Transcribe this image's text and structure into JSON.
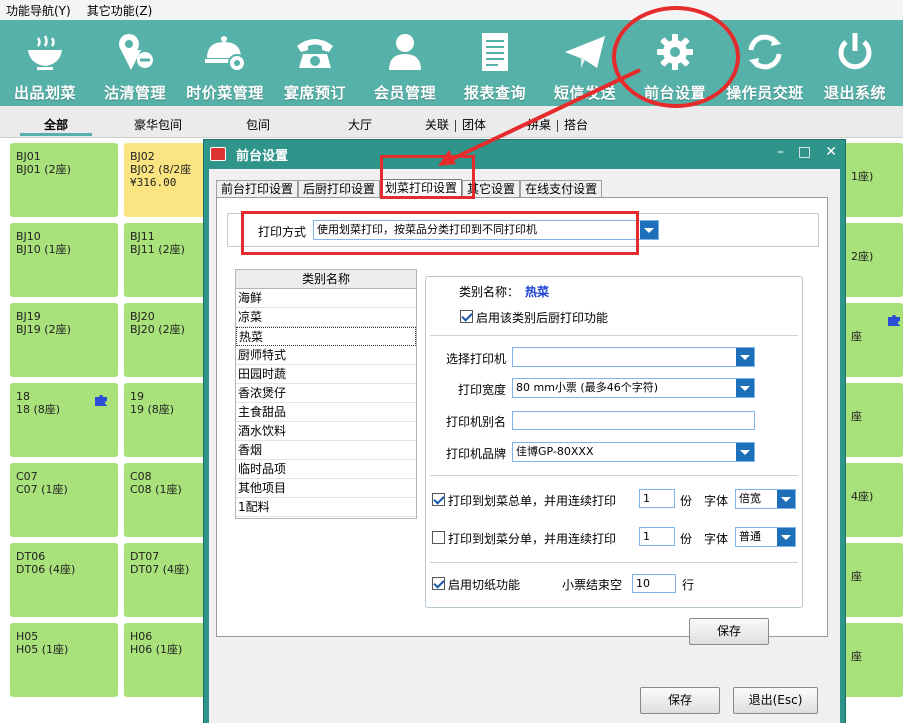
{
  "menu": [
    "功能导航(Y)",
    "其它功能(Z)"
  ],
  "toolbar": [
    {
      "label": "出品划菜",
      "icon": "bowl-icon"
    },
    {
      "label": "沽清管理",
      "icon": "tag-icon"
    },
    {
      "label": "时价菜管理",
      "icon": "food-gear-icon"
    },
    {
      "label": "宴席预订",
      "icon": "phone-icon"
    },
    {
      "label": "会员管理",
      "icon": "user-icon"
    },
    {
      "label": "报表查询",
      "icon": "report-icon"
    },
    {
      "label": "短信发送",
      "icon": "mail-icon"
    },
    {
      "label": "前台设置",
      "icon": "gear-icon"
    },
    {
      "label": "操作员交班",
      "icon": "refresh-icon"
    },
    {
      "label": "退出系统",
      "icon": "power-icon"
    }
  ],
  "areas": [
    "全部",
    "豪华包间",
    "包间",
    "大厅",
    "关联",
    "团体",
    "拼桌",
    "搭台"
  ],
  "tables": [
    {
      "name": "BJ01",
      "seat": "BJ01 (2座)",
      "amount": ""
    },
    {
      "name": "BJ02",
      "seat": "BJ02 (8/2座",
      "amount": "¥316.00"
    },
    {
      "name": "BJ10",
      "seat": "BJ10 (1座)",
      "amount": ""
    },
    {
      "name": "BJ11",
      "seat": "BJ11 (2座)",
      "amount": ""
    },
    {
      "name": "BJ19",
      "seat": "BJ19 (2座)",
      "amount": ""
    },
    {
      "name": "BJ20",
      "seat": "BJ20 (2座)",
      "amount": ""
    },
    {
      "name": "18",
      "seat": "18 (8座)",
      "amount": ""
    },
    {
      "name": "19",
      "seat": "19 (8座)",
      "amount": ""
    },
    {
      "name": "C07",
      "seat": "C07 (1座)",
      "amount": ""
    },
    {
      "name": "C08",
      "seat": "C08 (1座)",
      "amount": ""
    },
    {
      "name": "DT06",
      "seat": "DT06 (4座)",
      "amount": ""
    },
    {
      "name": "DT07",
      "seat": "DT07 (4座)",
      "amount": ""
    },
    {
      "name": "H05",
      "seat": "H05 (1座)",
      "amount": ""
    },
    {
      "name": "H06",
      "seat": "H06 (1座)",
      "amount": ""
    }
  ],
  "right_tiles": [
    "1座)",
    "2座)",
    "座",
    "座",
    "4座)",
    "座",
    "座"
  ],
  "dialog": {
    "title": "前台设置",
    "tabs": [
      "前台打印设置",
      "后厨打印设置",
      "划菜打印设置",
      "其它设置",
      "在线支付设置"
    ],
    "print_mode_label": "打印方式",
    "print_mode_value": "使用划菜打印，按菜品分类打印到不同打印机",
    "category_header": "类别名称",
    "categories": [
      "海鲜",
      "凉菜",
      "热菜",
      "厨师特式",
      "田园时蔬",
      "香浓煲仔",
      "主食甜品",
      "酒水饮料",
      "香烟",
      "临时品项",
      "其他项目",
      "1配料"
    ],
    "selected_category": "热菜",
    "detail": {
      "category_label": "类别名称：",
      "category_value": "热菜",
      "enable_label": "启用该类别后厨打印功能",
      "printer_label": "选择打印机",
      "printer_value": "",
      "width_label": "打印宽度",
      "width_value": "80 mm小票 (最多46个字符)",
      "alias_label": "打印机别名",
      "alias_value": "",
      "brand_label": "打印机品牌",
      "brand_value": "佳博GP-80XXX",
      "total_label": "打印到划菜总单，并用连续打印",
      "total_copies": "1",
      "copies_unit": "份",
      "font_label": "字体",
      "total_font": "倍宽",
      "split_label": "打印到划菜分单，并用连续打印",
      "split_copies": "1",
      "split_font": "普通",
      "cut_label": "启用切纸功能",
      "blank_label": "小票结束空",
      "blank_value": "10",
      "blank_unit": "行",
      "save_label": "保存"
    },
    "save_label": "保存",
    "exit_label": "退出(Esc)"
  }
}
